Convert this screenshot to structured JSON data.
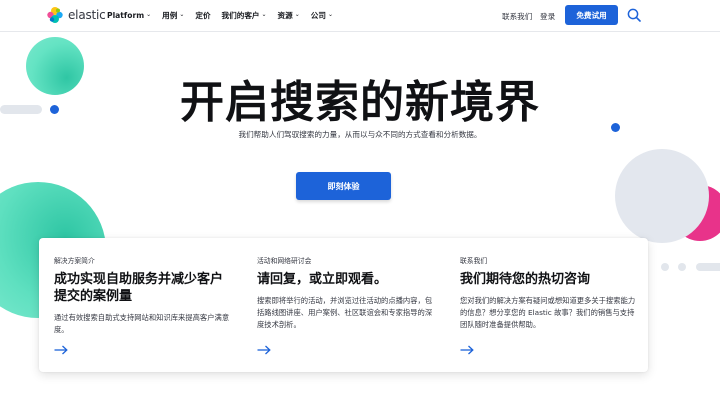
{
  "header": {
    "brand": "elastic",
    "nav": [
      {
        "label": "Platform",
        "has_menu": true
      },
      {
        "label": "用例",
        "has_menu": true
      },
      {
        "label": "定价",
        "has_menu": false
      },
      {
        "label": "我们的客户",
        "has_menu": true
      },
      {
        "label": "资源",
        "has_menu": true
      },
      {
        "label": "公司",
        "has_menu": true
      }
    ],
    "contact": "联系我们",
    "login": "登录",
    "trial": "免费试用"
  },
  "hero": {
    "title": "开启搜索的新境界",
    "subtitle": "我们帮助人们驾驭搜索的力量，从而以与众不同的方式查看和分析数据。",
    "cta": "即刻体验"
  },
  "cards": [
    {
      "eyebrow": "解决方案简介",
      "title": "成功实现自助服务并减少客户提交的案例量",
      "body": "通过有效搜索自助式支持网站和知识库来提高客户满意度。"
    },
    {
      "eyebrow": "活动和网络研讨会",
      "title": "请回复，或立即观看。",
      "body": "搜索即将举行的活动，并浏览过往活动的点播内容，包括路线图讲座、用户案例、社区联谊会和专家指导的深度技术剖析。"
    },
    {
      "eyebrow": "联系我们",
      "title": "我们期待您的热切咨询",
      "body": "您对我们的解决方案有疑问或想知道更多关于搜索能力的信息？想分享您的 Elastic 故事？我们的销售与支持团队随时准备提供帮助。"
    }
  ],
  "colors": {
    "primary": "#1d63d9",
    "teal": "#48e0b8",
    "pink": "#e8338a",
    "gray_blob": "#dfe4ec"
  },
  "icons": {
    "search": "search-icon",
    "chevron": "chevron-down-icon",
    "arrow": "arrow-right-icon"
  }
}
